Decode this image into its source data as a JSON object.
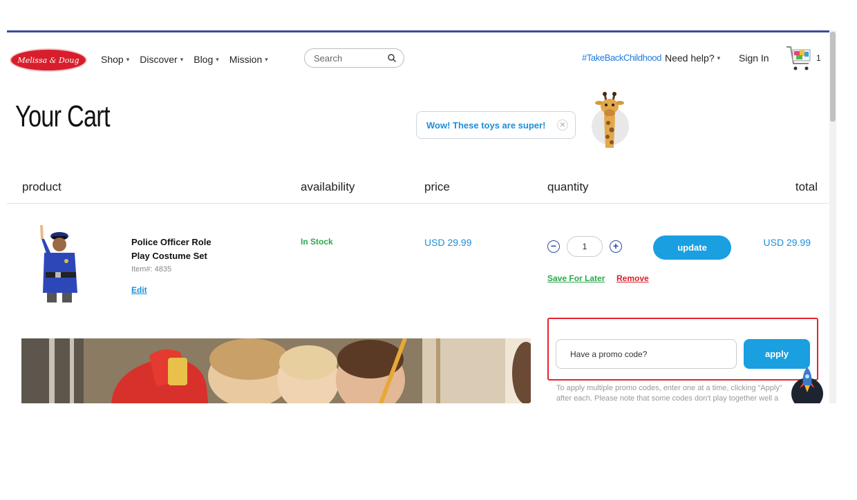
{
  "header": {
    "logo_text": "Melissa & Doug",
    "nav": [
      {
        "label": "Shop"
      },
      {
        "label": "Discover"
      },
      {
        "label": "Blog"
      },
      {
        "label": "Mission"
      }
    ],
    "search_placeholder": "Search",
    "hashtag": "#TakeBackChildhood",
    "help": "Need help?",
    "sign_in": "Sign In",
    "cart_count": "1"
  },
  "page": {
    "title": "Your Cart",
    "mascot_message": "Wow! These toys are super!"
  },
  "table": {
    "headers": {
      "product": "product",
      "availability": "availability",
      "price": "price",
      "quantity": "quantity",
      "total": "total"
    }
  },
  "item": {
    "name": "Police Officer Role Play Costume Set",
    "item_number": "Item#: 4835",
    "edit": "Edit",
    "availability": "In Stock",
    "price": "USD 29.99",
    "quantity": "1",
    "update": "update",
    "total": "USD 29.99",
    "save_for_later": "Save For Later",
    "remove": "Remove"
  },
  "promo": {
    "placeholder": "Have a promo code?",
    "apply": "apply",
    "note_line1": "To apply multiple promo codes, enter one at a time, clicking “Apply”",
    "note_line2": "after each. Please note that some codes don't play together well a"
  },
  "colors": {
    "brand_red": "#d81e2c",
    "accent_blue": "#1a9fe0",
    "stock_green": "#2ba84a",
    "highlight_red": "#e8222b"
  }
}
